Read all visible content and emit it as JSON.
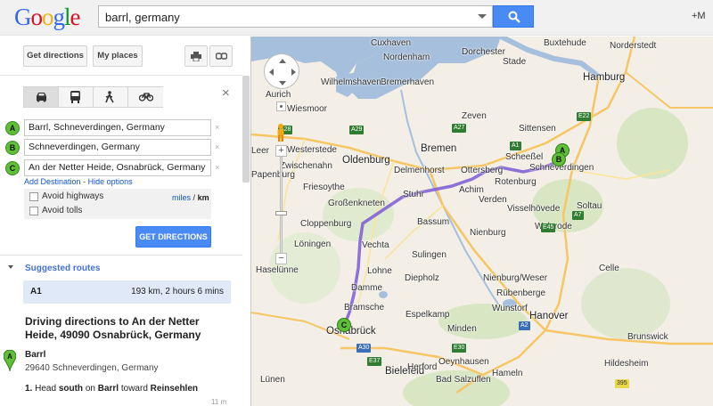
{
  "header": {
    "logo_letters": [
      "G",
      "o",
      "o",
      "g",
      "l",
      "e"
    ],
    "search_value": "barrl, germany",
    "user_plus": "+M"
  },
  "panel": {
    "get_directions_label": "Get directions",
    "my_places_label": "My places",
    "print_icon": "printer-icon",
    "link_icon": "link-icon",
    "modes": [
      {
        "icon": "car-icon",
        "active": true
      },
      {
        "icon": "bus-icon",
        "active": false
      },
      {
        "icon": "walk-icon",
        "active": false
      },
      {
        "icon": "bike-icon",
        "active": false
      }
    ],
    "close_symbol": "×",
    "waypoints": [
      {
        "letter": "A",
        "value": "Barrl, Schneverdingen, Germany"
      },
      {
        "letter": "B",
        "value": "Schneverdingen, Germany"
      },
      {
        "letter": "C",
        "value": "An der Netter Heide, Osnabrück, Germany"
      }
    ],
    "remove_symbol": "×",
    "add_destination": "Add Destination",
    "link_separator": "-",
    "hide_options": "Hide options",
    "avoid_highways": "Avoid highways",
    "avoid_tolls": "Avoid tolls",
    "units_miles": "miles",
    "units_sep": "/",
    "units_km": "km",
    "get_directions_btn": "GET DIRECTIONS",
    "suggested_routes": "Suggested routes",
    "route": {
      "name": "A1",
      "info": "193 km, 2 hours 6 mins"
    },
    "driving_title": "Driving directions to An der Netter Heide, 49090 Osnabrück, Germany",
    "start_letter": "A",
    "start_name": "Barrl",
    "start_address": "29640 Schneverdingen, Germany",
    "step1_number": "1.",
    "step1_head": "Head",
    "step1_dir": "south",
    "step1_on": "on",
    "step1_road": "Barrl",
    "step1_toward": "toward",
    "step1_dest": "Reinsehlen",
    "step1_distance": "11 m"
  },
  "map": {
    "cities": [
      {
        "name": "Cuxhaven",
        "big": false
      },
      {
        "name": "Stade",
        "big": false
      },
      {
        "name": "Hamburg",
        "big": true
      },
      {
        "name": "Nordenham",
        "big": false
      },
      {
        "name": "Bremerhaven",
        "big": false
      },
      {
        "name": "Wilhelmshaven",
        "big": false
      },
      {
        "name": "Aurich",
        "big": false
      },
      {
        "name": "Wiesmoor",
        "big": false
      },
      {
        "name": "Leer",
        "big": false
      },
      {
        "name": "Oldenburg",
        "big": true
      },
      {
        "name": "Bremen",
        "big": true
      },
      {
        "name": "Delmenhorst",
        "big": false
      },
      {
        "name": "Ottersberg",
        "big": false
      },
      {
        "name": "Achim",
        "big": false
      },
      {
        "name": "Rotenburg",
        "big": false
      },
      {
        "name": "Scheeßel",
        "big": false
      },
      {
        "name": "Schneverdingen",
        "big": false
      },
      {
        "name": "Buxtehude",
        "big": false
      },
      {
        "name": "Zeven",
        "big": false
      },
      {
        "name": "Sittensen",
        "big": false
      },
      {
        "name": "Verden",
        "big": false
      },
      {
        "name": "Visselhövede",
        "big": false
      },
      {
        "name": "Soltau",
        "big": false
      },
      {
        "name": "Walsrode",
        "big": false
      },
      {
        "name": "Cloppenburg",
        "big": false
      },
      {
        "name": "Friesoythe",
        "big": false
      },
      {
        "name": "Großenkneten",
        "big": false
      },
      {
        "name": "Bassum",
        "big": false
      },
      {
        "name": "Vechta",
        "big": false
      },
      {
        "name": "Diepholz",
        "big": false
      },
      {
        "name": "Nienburg",
        "big": false
      },
      {
        "name": "Löningen",
        "big": false
      },
      {
        "name": "Lohne",
        "big": false
      },
      {
        "name": "Damme",
        "big": false
      },
      {
        "name": "Bramsche",
        "big": false
      },
      {
        "name": "Osnabrück",
        "big": true
      },
      {
        "name": "Espelkamp",
        "big": false
      },
      {
        "name": "Minden",
        "big": false
      },
      {
        "name": "Hanover",
        "big": true
      },
      {
        "name": "Wunstorf",
        "big": false
      },
      {
        "name": "Bielefeld",
        "big": true
      },
      {
        "name": "Herford",
        "big": false
      },
      {
        "name": "Bad Salzuflen",
        "big": false
      },
      {
        "name": "Hameln",
        "big": false
      },
      {
        "name": "Hildesheim",
        "big": false
      },
      {
        "name": "Brunswick",
        "big": false
      },
      {
        "name": "Papenburg",
        "big": false
      },
      {
        "name": "Westerstede",
        "big": false
      },
      {
        "name": "Zwischenahn",
        "big": false
      },
      {
        "name": "Stuhr",
        "big": false
      },
      {
        "name": "Sulingen",
        "big": false
      },
      {
        "name": "Celle",
        "big": false
      },
      {
        "name": "Oeynhausen",
        "big": false
      },
      {
        "name": "Dorchester",
        "big": false
      },
      {
        "name": "Norderstedt",
        "big": false
      },
      {
        "name": "Nienburg/Weser",
        "big": false
      },
      {
        "name": "Rübenberge",
        "big": false
      },
      {
        "name": "Haselünne",
        "big": false
      },
      {
        "name": "Lünen",
        "big": false
      }
    ],
    "pins": [
      "A",
      "B",
      "C"
    ],
    "shields": [
      "A28",
      "A29",
      "A1",
      "A27",
      "A7",
      "E22",
      "E45",
      "A2",
      "E30",
      "A30",
      "E37",
      "395"
    ]
  }
}
